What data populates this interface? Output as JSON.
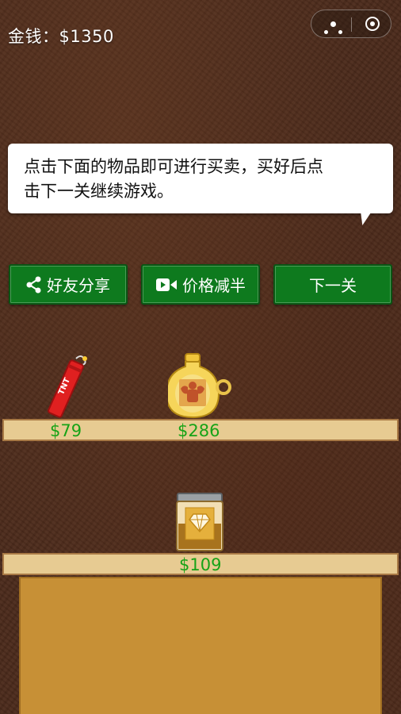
{
  "header": {
    "money_label": "金钱：$1350"
  },
  "capsule": {
    "more_icon": "more-dots-icon",
    "close_icon": "target-close-icon"
  },
  "dialog": {
    "text_line1": "点击下面的物品即可进行买卖，买好后点",
    "text_line2": "击下一关继续游戏。"
  },
  "buttons": {
    "share": "好友分享",
    "half_price": "价格减半",
    "next_level": "下一关"
  },
  "shelf_items": [
    {
      "name": "TNT",
      "icon": "tnt-dynamite-icon",
      "price": "$79"
    },
    {
      "name": "strength potion",
      "icon": "muscle-potion-icon",
      "price": "$286"
    },
    {
      "name": "diamond jar",
      "icon": "diamond-jar-icon",
      "price": "$109"
    }
  ],
  "colors": {
    "button_green": "#0e7a1e",
    "price_green": "#17a317",
    "shelf": "#e7cb92",
    "counter": "#c79036"
  }
}
